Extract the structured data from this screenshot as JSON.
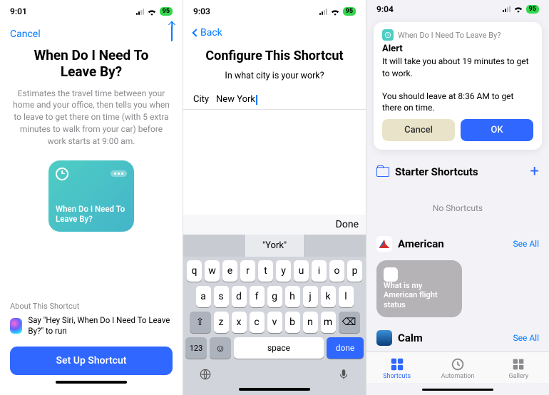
{
  "screen1": {
    "status": {
      "time": "9:01",
      "battery": "95"
    },
    "nav": {
      "cancel": "Cancel"
    },
    "title": "When Do I Need To Leave By?",
    "description": "Estimates the travel time between your home and your office, then tells you when to leave to get there on time (with 5 extra minutes to walk from your car) before work starts at 9:00 am.",
    "tile_label": "When Do I Need To Leave By?",
    "about_label": "About This Shortcut",
    "siri_hint": "Say \"Hey Siri, When Do I Need To Leave By?\" to run",
    "setup_button": "Set Up Shortcut"
  },
  "screen2": {
    "status": {
      "time": "9:03",
      "battery": "95"
    },
    "nav": {
      "back": "Back"
    },
    "title": "Configure This Shortcut",
    "question": "In what city is your work?",
    "field_label": "City",
    "field_value": "New York",
    "keyboard": {
      "done_bar": "Done",
      "suggestions": [
        "",
        "\"York\"",
        ""
      ],
      "row1": [
        "q",
        "w",
        "e",
        "r",
        "t",
        "y",
        "u",
        "i",
        "o",
        "p"
      ],
      "row2": [
        "a",
        "s",
        "d",
        "f",
        "g",
        "h",
        "j",
        "k",
        "l"
      ],
      "row3_shift": "⇧",
      "row3": [
        "z",
        "x",
        "c",
        "v",
        "b",
        "n",
        "m"
      ],
      "row3_del": "⌫",
      "num_key": "123",
      "emoji_key": "☺",
      "space": "space",
      "done": "done"
    }
  },
  "screen3": {
    "status": {
      "time": "9:04",
      "battery": "95"
    },
    "alert": {
      "app_name": "When Do I Need To Leave By?",
      "title": "Alert",
      "line1": "It will take you about 19 minutes to get to work.",
      "line2": "You should leave at 8:36 AM to get there on time.",
      "cancel": "Cancel",
      "ok": "OK"
    },
    "starter": {
      "label": "Starter Shortcuts",
      "empty": "No Shortcuts"
    },
    "apps": {
      "american": {
        "name": "American",
        "seeall": "See All",
        "tile": "What is my American flight status"
      },
      "calm": {
        "name": "Calm",
        "seeall": "See All"
      }
    },
    "tabs": {
      "shortcuts": "Shortcuts",
      "automation": "Automation",
      "gallery": "Gallery"
    }
  }
}
